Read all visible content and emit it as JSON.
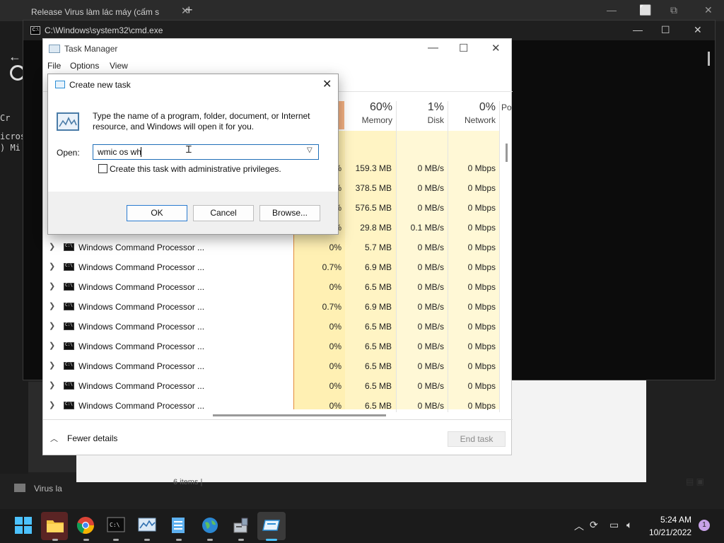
{
  "browser": {
    "tab_title": "Release Virus làm lác máy (cấm s",
    "new_tab": "+",
    "close": "✕",
    "controls": [
      "—",
      "⬜",
      "⧉",
      "✕"
    ]
  },
  "background": {
    "left_text1": "Cr",
    "left_text2": "icros",
    "left_text3": ") Mi",
    "virus_label": "Virus la",
    "explorer_status": "6 items  |"
  },
  "cmd": {
    "title": "C:\\Windows\\system32\\cmd.exe",
    "controls": [
      "—",
      "☐",
      "✕"
    ]
  },
  "task_manager": {
    "title": "Task Manager",
    "menu": [
      "File",
      "Options",
      "View"
    ],
    "controls": [
      "—",
      "☐",
      "✕"
    ],
    "columns": [
      {
        "pct": "60%",
        "label": "Memory"
      },
      {
        "pct": "1%",
        "label": "Disk"
      },
      {
        "pct": "0%",
        "label": "Network"
      },
      {
        "pct": "",
        "label": "Po"
      }
    ],
    "partial_rows": [
      {
        "cpu": "%",
        "mem": "159.3 MB",
        "disk": "0 MB/s",
        "net": "0 Mbps"
      },
      {
        "cpu": "%",
        "mem": "378.5 MB",
        "disk": "0 MB/s",
        "net": "0 Mbps"
      },
      {
        "cpu": "%",
        "mem": "576.5 MB",
        "disk": "0 MB/s",
        "net": "0 Mbps"
      },
      {
        "cpu": "%",
        "mem": "29.8 MB",
        "disk": "0.1 MB/s",
        "net": "0 Mbps"
      }
    ],
    "rows": [
      {
        "name": "Windows Command Processor ...",
        "cpu": "0%",
        "mem": "5.7 MB",
        "disk": "0 MB/s",
        "net": "0 Mbps"
      },
      {
        "name": "Windows Command Processor ...",
        "cpu": "0.7%",
        "mem": "6.9 MB",
        "disk": "0 MB/s",
        "net": "0 Mbps"
      },
      {
        "name": "Windows Command Processor ...",
        "cpu": "0%",
        "mem": "6.5 MB",
        "disk": "0 MB/s",
        "net": "0 Mbps"
      },
      {
        "name": "Windows Command Processor ...",
        "cpu": "0.7%",
        "mem": "6.9 MB",
        "disk": "0 MB/s",
        "net": "0 Mbps"
      },
      {
        "name": "Windows Command Processor ...",
        "cpu": "0%",
        "mem": "6.5 MB",
        "disk": "0 MB/s",
        "net": "0 Mbps"
      },
      {
        "name": "Windows Command Processor ...",
        "cpu": "0%",
        "mem": "6.5 MB",
        "disk": "0 MB/s",
        "net": "0 Mbps"
      },
      {
        "name": "Windows Command Processor ...",
        "cpu": "0%",
        "mem": "6.5 MB",
        "disk": "0 MB/s",
        "net": "0 Mbps"
      },
      {
        "name": "Windows Command Processor ...",
        "cpu": "0%",
        "mem": "6.5 MB",
        "disk": "0 MB/s",
        "net": "0 Mbps"
      },
      {
        "name": "Windows Command Processor ...",
        "cpu": "0%",
        "mem": "6.5 MB",
        "disk": "0 MB/s",
        "net": "0 Mbps"
      }
    ],
    "fewer_details": "Fewer details",
    "end_task": "End task"
  },
  "run_dialog": {
    "title": "Create new task",
    "description": "Type the name of a program, folder, document, or Internet resource, and Windows will open it for you.",
    "open_label": "Open:",
    "input_value": "wmic os wh",
    "admin_checkbox_label": "Create this task with administrative privileges.",
    "admin_checked": false,
    "ok": "OK",
    "cancel": "Cancel",
    "browse": "Browse..."
  },
  "taskbar": {
    "time": "5:24 AM",
    "date": "10/21/2022",
    "notification_count": "1",
    "icons": [
      "windows-start-icon",
      "file-explorer-icon",
      "chrome-icon",
      "terminal-icon",
      "task-manager-icon",
      "notepad-icon",
      "globe-network-icon",
      "installer-icon",
      "run-dialog-icon"
    ],
    "tray": [
      "chevron-up-icon",
      "sync-icon",
      "display-icon",
      "volume-icon"
    ]
  }
}
